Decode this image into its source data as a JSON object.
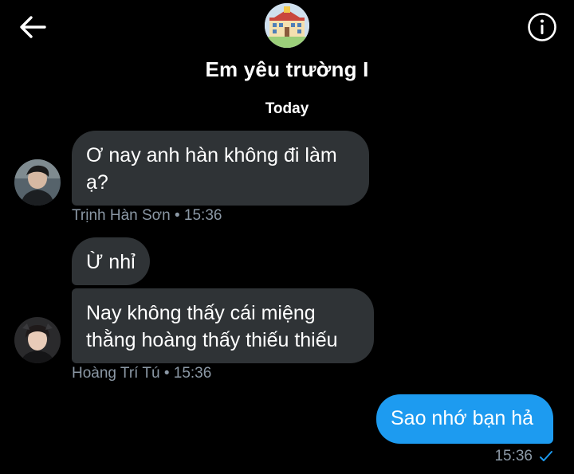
{
  "header": {
    "title": "Em yêu trường I",
    "back_icon": "back-arrow-icon",
    "info_icon": "info-icon"
  },
  "conversation": {
    "day_label": "Today",
    "messages": [
      {
        "sender": "Trịnh Hàn Sơn",
        "text": "Ơ nay anh hàn không đi làm ạ?",
        "direction": "incoming"
      },
      {
        "sender": "Hoàng Trí Tú",
        "text": "Ừ nhỉ",
        "direction": "incoming"
      },
      {
        "sender": "Hoàng Trí Tú",
        "text": "Nay không thấy cái miệng thằng hoàng thấy thiếu thiếu",
        "direction": "incoming"
      },
      {
        "sender": "",
        "text": "Sao nhớ bạn hả",
        "direction": "outgoing"
      }
    ],
    "meta1": "Trịnh Hàn Sơn • 15:36",
    "meta2": "Hoàng Trí Tú • 15:36",
    "meta3_time": "15:36"
  },
  "colors": {
    "background": "#000000",
    "incoming_bubble": "#2f3336",
    "outgoing_bubble": "#1d9bf0",
    "meta_text": "#8b98a5",
    "seen_check": "#1d9bf0"
  }
}
